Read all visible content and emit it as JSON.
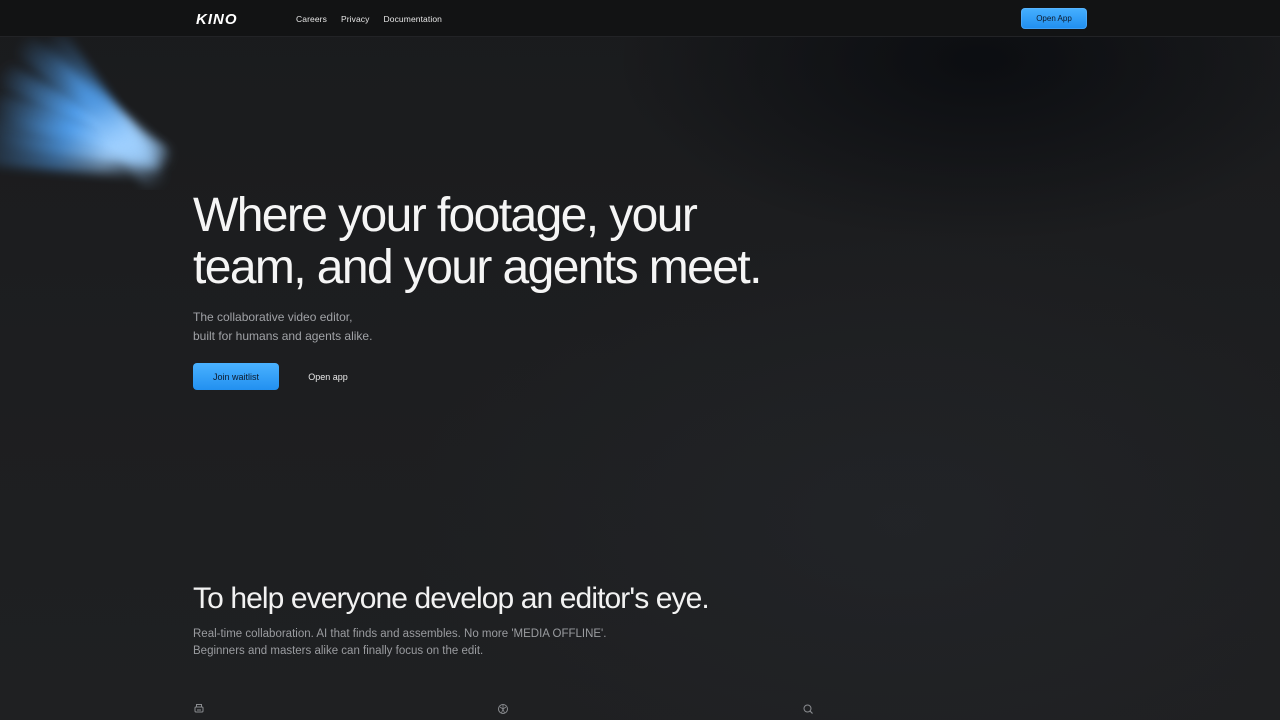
{
  "header": {
    "logo_text": "KINO",
    "nav": [
      {
        "label": "Careers"
      },
      {
        "label": "Privacy"
      },
      {
        "label": "Documentation"
      }
    ],
    "open_app_label": "Open App"
  },
  "hero": {
    "title_line1": "Where your footage, your",
    "title_line2": "team, and your agents meet.",
    "subtitle_line1": "The collaborative video editor,",
    "subtitle_line2": "built for humans and agents alike.",
    "primary_cta": "Join waitlist",
    "secondary_cta": "Open app"
  },
  "section": {
    "title": "To help everyone develop an editor's eye.",
    "desc_line1": "Real-time collaboration. AI that finds and assembles. No more 'MEDIA OFFLINE'.",
    "desc_line2": "Beginners and masters alike can finally focus on the edit."
  },
  "feature_icons": [
    "printer-icon",
    "aperture-icon",
    "search-icon"
  ],
  "colors": {
    "accent": "#2a9bf5",
    "background": "#1c1d1f",
    "header_bg": "#121314"
  }
}
